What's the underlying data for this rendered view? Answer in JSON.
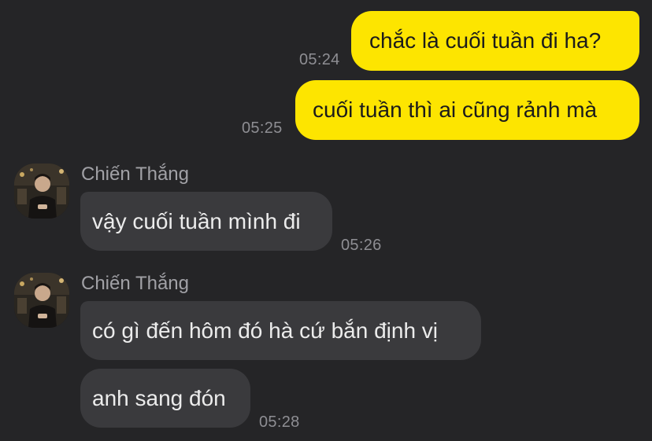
{
  "messages": {
    "m1": {
      "text": "chắc là cuối tuần đi ha?",
      "time": "05:24"
    },
    "m2": {
      "text": "cuối tuần thì ai cũng rảnh mà",
      "time": "05:25"
    },
    "m3": {
      "sender": "Chiến Thắng",
      "text": "vậy cuối tuần mình đi",
      "time": "05:26"
    },
    "m4": {
      "sender": "Chiến Thắng",
      "text": "có gì đến hôm đó hà cứ bắn định vị"
    },
    "m5": {
      "text": "anh sang đón",
      "time": "05:28"
    }
  },
  "colors": {
    "background": "#252527",
    "outgoing_bubble": "#fde500",
    "incoming_bubble": "#3a3a3d"
  }
}
